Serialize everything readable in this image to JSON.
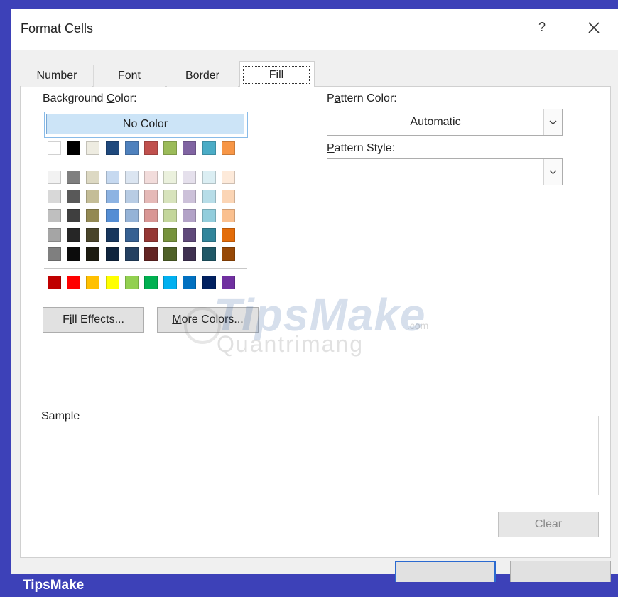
{
  "window": {
    "title": "Format Cells",
    "help_label": "?",
    "close_icon": "close-icon"
  },
  "tabs": [
    {
      "label": "Number",
      "selected": false
    },
    {
      "label": "Font",
      "selected": false
    },
    {
      "label": "Border",
      "selected": false
    },
    {
      "label": "Fill",
      "selected": true
    }
  ],
  "background_color": {
    "label_pre": "Background ",
    "label_key": "C",
    "label_post": "olor:",
    "no_color_label": "No Color",
    "theme_base": [
      "#ffffff",
      "#000000",
      "#eeece1",
      "#1f497d",
      "#4f81bd",
      "#c0504d",
      "#9bbb59",
      "#8064a2",
      "#4bacc6",
      "#f79646"
    ],
    "theme_shades": [
      [
        "#f2f2f2",
        "#7f7f7f",
        "#ddd9c3",
        "#c6d9f0",
        "#dbe5f1",
        "#f2dcdb",
        "#ebf1dd",
        "#e5e0ec",
        "#dbeef3",
        "#fdeada"
      ],
      [
        "#d8d8d8",
        "#595959",
        "#c4bd97",
        "#8db3e2",
        "#b8cce4",
        "#e5b9b7",
        "#d7e3bc",
        "#ccc1d9",
        "#b7dde8",
        "#fbd5b5"
      ],
      [
        "#bfbfbf",
        "#3f3f3f",
        "#938953",
        "#548dd4",
        "#95b3d7",
        "#d99694",
        "#c3d69b",
        "#b2a2c7",
        "#92cddc",
        "#fac08f"
      ],
      [
        "#a5a5a5",
        "#262626",
        "#494429",
        "#17365d",
        "#366092",
        "#953734",
        "#76923c",
        "#5f497a",
        "#31859b",
        "#e36c09"
      ],
      [
        "#7f7f7f",
        "#0c0c0c",
        "#1d1b10",
        "#0f243e",
        "#244061",
        "#632423",
        "#4f6128",
        "#3f3151",
        "#205867",
        "#974806"
      ]
    ],
    "standard": [
      "#c00000",
      "#ff0000",
      "#ffc000",
      "#ffff00",
      "#92d050",
      "#00b050",
      "#00b0f0",
      "#0070c0",
      "#002060",
      "#7030a0"
    ]
  },
  "buttons": {
    "fill_effects_pre": "F",
    "fill_effects_key": "i",
    "fill_effects_post": "ll Effects...",
    "more_colors_pre": "",
    "more_colors_key": "M",
    "more_colors_post": "ore Colors...",
    "clear_label": "Clear"
  },
  "pattern_color": {
    "label_pre": "P",
    "label_key": "a",
    "label_post": "ttern Color:",
    "value": "Automatic"
  },
  "pattern_style": {
    "label_pre": "",
    "label_key": "P",
    "label_post": "attern Style:",
    "value": ""
  },
  "sample": {
    "label": "Sample"
  },
  "watermark": {
    "main": "TipsMake",
    "sub": "Quantrimang",
    "suffix": ".com"
  },
  "footer": {
    "brand": "TipsMake"
  }
}
